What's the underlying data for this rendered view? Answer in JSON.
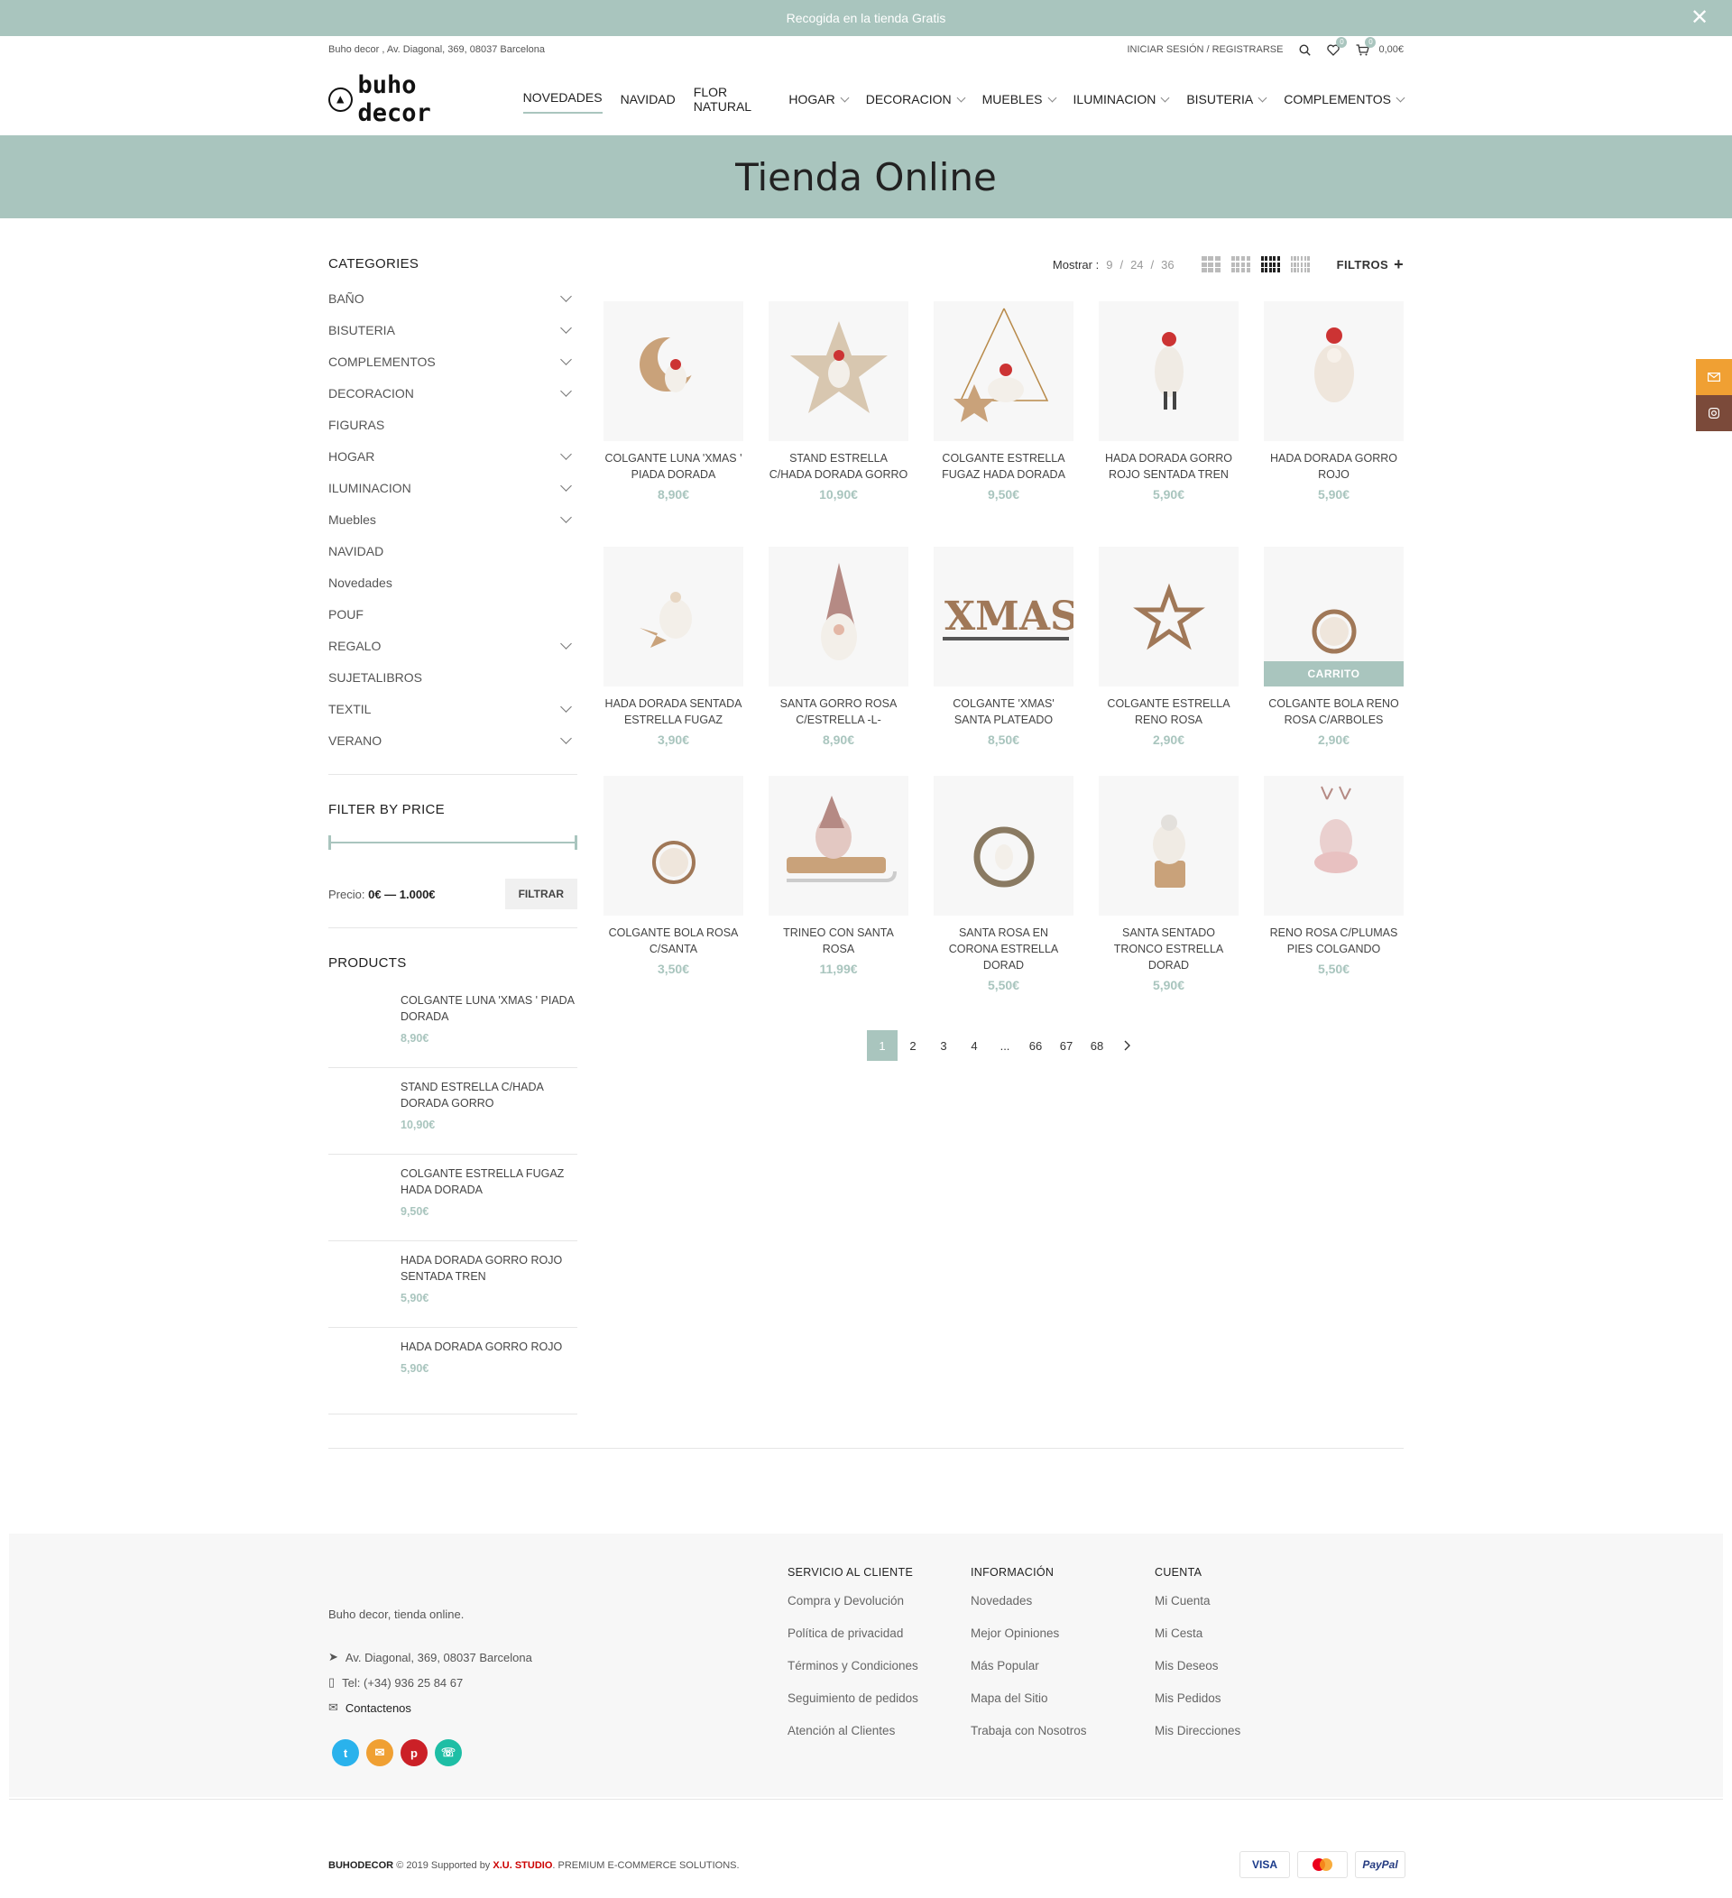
{
  "promo": {
    "text": "Recogida en la tienda Gratis",
    "close": "✕"
  },
  "topbar": {
    "address": "Buho decor , Av. Diagonal, 369, 08037 Barcelona",
    "login": "INICIAR SESIÓN / REGISTRARSE",
    "wishlist_count": "0",
    "cart_count": "0",
    "cart_total": "0,00€"
  },
  "header": {
    "logo": "buho decor",
    "nav": [
      "NOVEDADES",
      "NAVIDAD",
      "FLOR NATURAL",
      "HOGAR",
      "DECORACION",
      "MUEBLES",
      "ILUMINACION",
      "BISUTERIA",
      "COMPLEMENTOS"
    ]
  },
  "hero": {
    "title": "Tienda Online"
  },
  "sidebar": {
    "categories_title": "CATEGORIES",
    "categories": [
      "BAÑO",
      "BISUTERIA",
      "COMPLEMENTOS",
      "DECORACION",
      "FIGURAS",
      "HOGAR",
      "ILUMINACION",
      "Muebles",
      "NAVIDAD",
      "Novedades",
      "POUF",
      "REGALO",
      "SUJETALIBROS",
      "TEXTIL",
      "VERANO"
    ],
    "price_title": "FILTER BY PRICE",
    "price_label": "Precio:",
    "price_range": "0€ — 1.000€",
    "filter_button": "FILTRAR",
    "products_title": "PRODUCTS",
    "products": [
      {
        "name": "COLGANTE LUNA 'XMAS ' PIADA DORADA",
        "price": "8,90€"
      },
      {
        "name": "STAND ESTRELLA C/HADA DORADA GORRO",
        "price": "10,90€"
      },
      {
        "name": "COLGANTE ESTRELLA FUGAZ HADA DORADA",
        "price": "9,50€"
      },
      {
        "name": "HADA DORADA GORRO ROJO SENTADA TREN",
        "price": "5,90€"
      },
      {
        "name": "HADA DORADA GORRO ROJO",
        "price": "5,90€"
      }
    ]
  },
  "toolbar": {
    "mostrar": "Mostrar :",
    "options": [
      "9",
      "24",
      "36"
    ],
    "filtros": "FILTROS",
    "filtros_icon": "+"
  },
  "products": [
    {
      "name": "COLGANTE LUNA 'XMAS ' PIADA DORADA",
      "price": "8,90€"
    },
    {
      "name": "STAND ESTRELLA C/HADA DORADA GORRO",
      "price": "10,90€"
    },
    {
      "name": "COLGANTE ESTRELLA FUGAZ HADA DORADA",
      "price": "9,50€"
    },
    {
      "name": "HADA DORADA GORRO ROJO SENTADA TREN",
      "price": "5,90€"
    },
    {
      "name": "HADA DORADA GORRO ROJO",
      "price": "5,90€"
    },
    {
      "name": "HADA DORADA SENTADA ESTRELLA FUGAZ",
      "price": "3,90€"
    },
    {
      "name": "SANTA GORRO ROSA C/ESTRELLA -L-",
      "price": "8,90€"
    },
    {
      "name": "COLGANTE 'XMAS' SANTA PLATEADO",
      "price": "8,50€"
    },
    {
      "name": "COLGANTE ESTRELLA RENO ROSA",
      "price": "2,90€"
    },
    {
      "name": "COLGANTE BOLA RENO ROSA C/ARBOLES",
      "price": "2,90€",
      "carrito": "CARRITO"
    },
    {
      "name": "COLGANTE BOLA ROSA C/SANTA",
      "price": "3,50€"
    },
    {
      "name": "TRINEO CON SANTA ROSA",
      "price": "11,99€"
    },
    {
      "name": "SANTA ROSA EN CORONA ESTRELLA DORAD",
      "price": "5,50€"
    },
    {
      "name": "SANTA SENTADO TRONCO ESTRELLA DORAD",
      "price": "5,90€"
    },
    {
      "name": "RENO ROSA C/PLUMAS PIES COLGANDO",
      "price": "5,50€"
    }
  ],
  "pagination": [
    "1",
    "2",
    "3",
    "4",
    "...",
    "66",
    "67",
    "68"
  ],
  "footer": {
    "about": "Buho decor, tienda online.",
    "address": "Av. Diagonal, 369, 08037 Barcelona",
    "phone": "Tel: (+34) 936 25 84 67",
    "contact": "Contactenos",
    "columns": [
      {
        "title": "SERVICIO AL CLIENTE",
        "links": [
          "Compra y Devolución",
          "Política de privacidad",
          "Términos y Condiciones",
          "Seguimiento de pedidos",
          "Atención al Clientes"
        ]
      },
      {
        "title": "INFORMACIÓN",
        "links": [
          "Novedades",
          "Mejor Opiniones",
          "Más Popular",
          "Mapa del Sitio",
          "Trabaja con Nosotros"
        ]
      },
      {
        "title": "CUENTA",
        "links": [
          "Mi Cuenta",
          "Mi Cesta",
          "Mis Deseos",
          "Mis Pedidos",
          "Mis Direcciones"
        ]
      }
    ],
    "copyright_brand": "BUHODECOR",
    "copyright_text": "© 2019 Supported by",
    "studio": "X.U. STUDIO",
    "tagline": ". PREMIUM E-COMMERCE SOLUTIONS.",
    "payments": [
      "VISA",
      "MC",
      "PayPal"
    ]
  },
  "colors": {
    "accent": "#a9c5be",
    "float_mail": "#f0a033",
    "float_instagram": "#7b4a3a"
  }
}
